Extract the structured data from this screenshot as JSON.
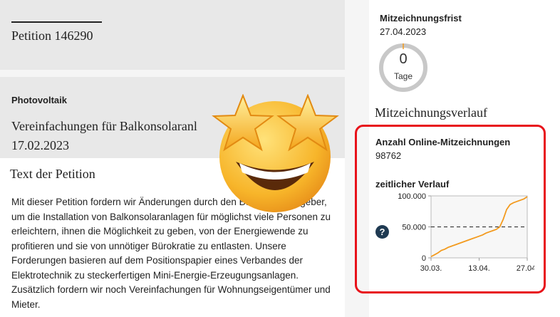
{
  "petition": {
    "number_label": "Petition 146290",
    "topic": "Photovoltaik",
    "title": "Vereinfachungen für Balkonsolaranl",
    "date": "17.02.2023",
    "text_heading": "Text der Petition",
    "body": "Mit dieser Petition fordern wir Änderungen durch den Bundesgesetzgeber, um die Installation von Balkonsolaranlagen für möglichst viele Personen zu erleichtern, ihnen die Möglichkeit zu geben, von der Energiewende zu profitieren und sie von unnötiger Bürokratie zu entlasten. Unsere Forderungen basieren auf dem Positionspapier eines Verbandes der Elektrotechnik zu steckerfertigen Mini-Energie-Erzeugungsanlagen. Zusätzlich fordern wir noch Vereinfachungen für Wohnungseigentümer und Mieter."
  },
  "sidebar": {
    "frist_label": "Mitzeichnungsfrist",
    "frist_date": "27.04.2023",
    "days_remaining": "0",
    "days_unit": "Tage",
    "verlauf_heading": "Mitzeichnungsverlauf",
    "online_label": "Anzahl Online-Mitzeichnungen",
    "online_count": "98762",
    "zeit_label": "zeitlicher Verlauf",
    "help_glyph": "?"
  },
  "colors": {
    "accent_red": "#e8131b",
    "line_orange": "#f39a1e",
    "ring_gray": "#c8c8c8"
  },
  "chart_data": {
    "type": "line",
    "x_tick_labels": [
      "30.03.",
      "13.04.",
      "27.04."
    ],
    "y_tick_labels": [
      "0",
      "50.000",
      "100.000"
    ],
    "ylim": [
      0,
      100000
    ],
    "xlim": [
      0,
      28
    ],
    "threshold": 50000,
    "series": [
      {
        "x": [
          0,
          1,
          2,
          3,
          4,
          5,
          6,
          7,
          8,
          9,
          10,
          11,
          12,
          13,
          14,
          15,
          16,
          17,
          18,
          19,
          20,
          21,
          22,
          23,
          24,
          25,
          26,
          27,
          28
        ],
        "y": [
          2000,
          5000,
          8000,
          12000,
          14000,
          17000,
          19000,
          21000,
          23000,
          25000,
          27000,
          29000,
          31000,
          33000,
          35000,
          37000,
          40000,
          42000,
          44000,
          46000,
          50000,
          62000,
          78000,
          86000,
          89000,
          91000,
          93000,
          95000,
          98762
        ]
      }
    ],
    "grid": true,
    "legend": "none"
  },
  "overlay": {
    "emoji_icon": "star-struck-emoji-icon"
  }
}
